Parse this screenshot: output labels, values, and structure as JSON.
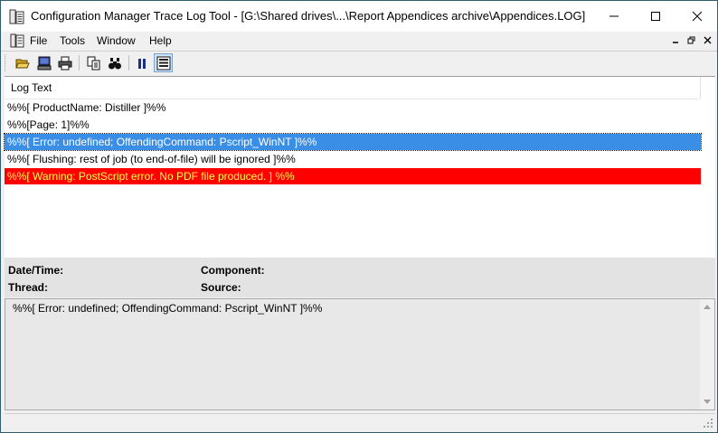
{
  "window": {
    "title": "Configuration Manager Trace Log Tool - [G:\\Shared drives\\...\\Report Appendices archive\\Appendices.LOG]"
  },
  "menu": {
    "items": [
      "File",
      "Tools",
      "Window",
      "Help"
    ]
  },
  "toolbar": {
    "buttons": [
      "open-folder-icon",
      "computer-icon",
      "print-icon",
      "copy-icon",
      "find-icon",
      "pause-icon",
      "filter-icon"
    ]
  },
  "log": {
    "column_header": "Log Text",
    "rows": [
      {
        "text": "%%[ ProductName: Distiller ]%%",
        "state": "normal"
      },
      {
        "text": "%%[Page: 1]%%",
        "state": "normal"
      },
      {
        "text": "%%[ Error: undefined; OffendingCommand: Pscript_WinNT ]%%",
        "state": "selected"
      },
      {
        "text": "%%[ Flushing: rest of job (to end-of-file) will be ignored ]%%",
        "state": "normal"
      },
      {
        "text": "%%[ Warning: PostScript error. No PDF file produced. ] %%",
        "state": "warning"
      }
    ]
  },
  "details": {
    "datetime_label": "Date/Time:",
    "component_label": "Component:",
    "thread_label": "Thread:",
    "source_label": "Source:",
    "message": "%%[ Error: undefined; OffendingCommand: Pscript_WinNT ]%%"
  },
  "colors": {
    "selected_row": "#3a8ee6",
    "warning_row": "#ff0000",
    "warning_text": "#ffff4a"
  }
}
